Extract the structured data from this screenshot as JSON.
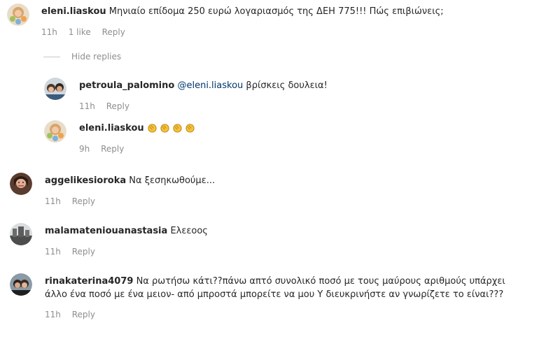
{
  "comments": [
    {
      "username": "eleni.liaskou",
      "text": "Μηνιαίο επίδομα 250 ευρώ λογαριασμός της ΔΕΗ 775!!! Πώς επιβιώνεις;",
      "time": "11h",
      "likes": "1 like",
      "reply_label": "Reply",
      "hide_replies_label": "Hide replies",
      "replies": [
        {
          "username": "petroula_palomino",
          "mention": "@eleni.liaskou",
          "text": "βρίσκεις δουλεια!",
          "time": "11h",
          "reply_label": "Reply"
        },
        {
          "username": "eleni.liaskou",
          "emoji": "clapping-hands x4",
          "time": "9h",
          "reply_label": "Reply"
        }
      ]
    },
    {
      "username": "aggelikesioroka",
      "text": "Να ξεσηκωθούμε...",
      "time": "11h",
      "reply_label": "Reply"
    },
    {
      "username": "malamateniouanastasia",
      "text": "Ελεεοος",
      "time": "11h",
      "reply_label": "Reply"
    },
    {
      "username": "rinakaterina4079",
      "text": "Να ρωτήσω κάτι??πάνω απτό συνολικό ποσό με τους μαύρους αριθμούς υπάρχει άλλο ένα ποσό με ένα μειον- από μπροστά μπορείτε να μου Υ διευκρινήστε αν γνωρίζετε το είναι???",
      "time": "11h",
      "reply_label": "Reply"
    }
  ]
}
